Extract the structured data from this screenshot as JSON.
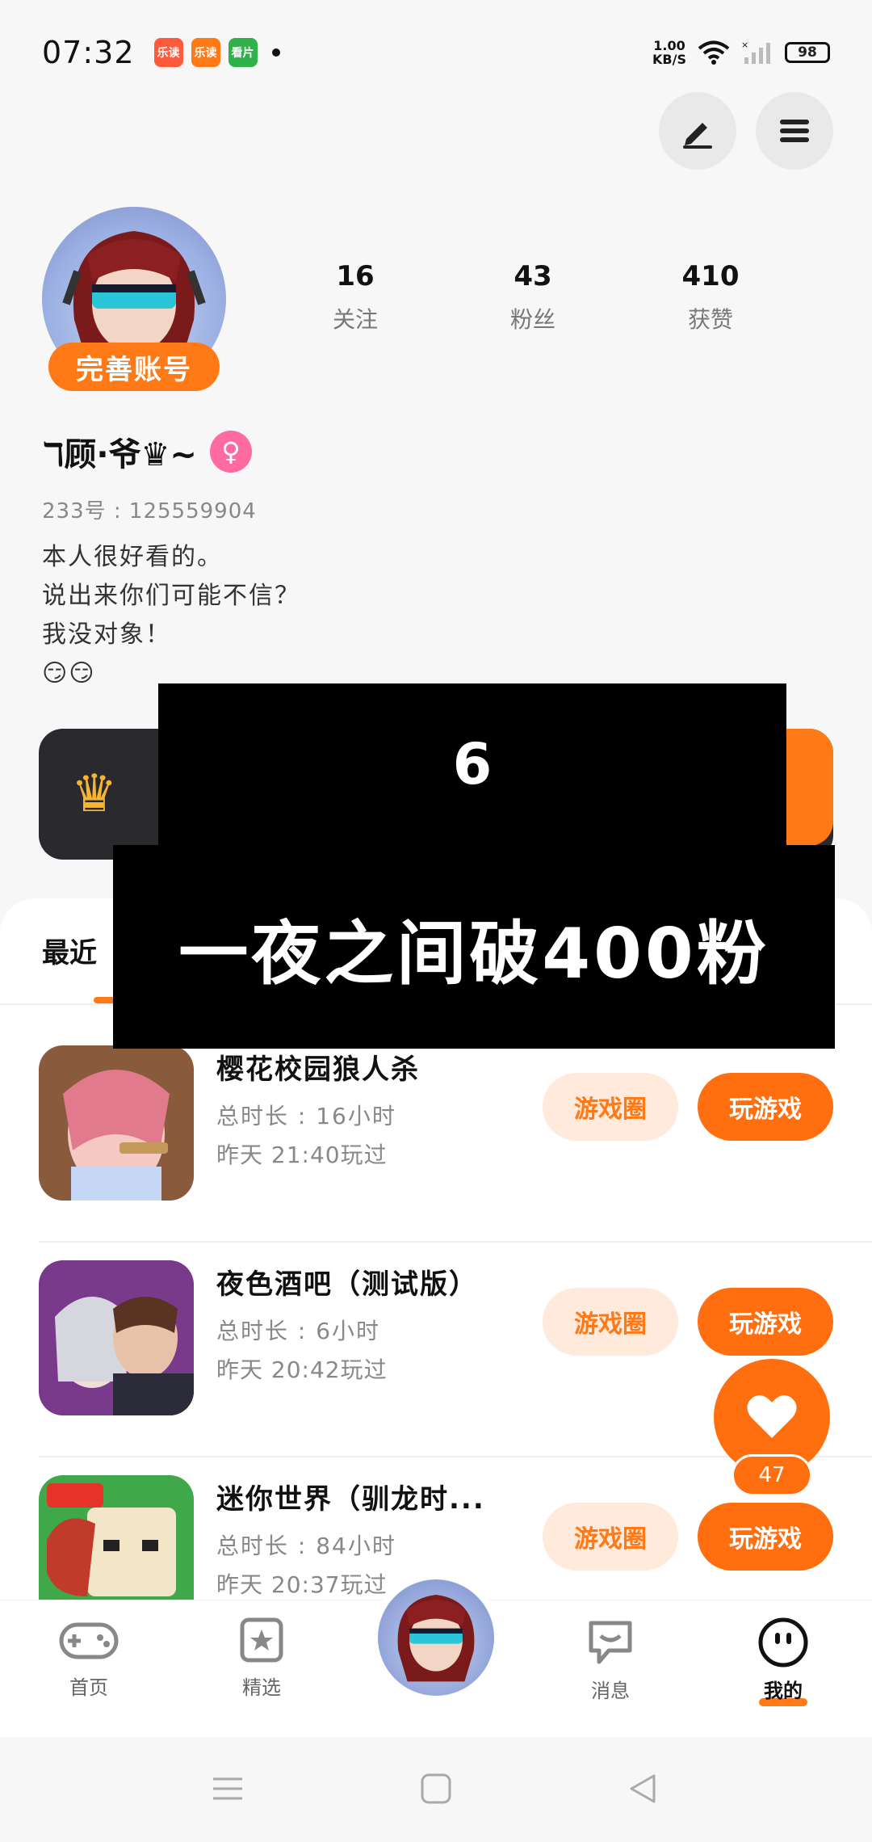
{
  "status_bar": {
    "time": "07:32",
    "net_speed_value": "1.00",
    "net_speed_unit": "KB/S",
    "battery": "98",
    "app_icons": [
      {
        "name": "app-icon-1",
        "color": "#ff5a3c",
        "label": "乐读"
      },
      {
        "name": "app-icon-2",
        "color": "#ff7a16",
        "label": "乐读"
      },
      {
        "name": "app-icon-3",
        "color": "#2fb14b",
        "label": "看片"
      }
    ]
  },
  "profile": {
    "complete_account_label": "完善账号",
    "nickname": "ℸ顾·爷♛~",
    "uid_label": "233号 : 125559904",
    "bio_lines": [
      "本人很好看的。",
      "说出来你们可能不信？",
      "我没对象！",
      "😏😏"
    ],
    "stats": [
      {
        "value": "16",
        "label": "关注"
      },
      {
        "value": "43",
        "label": "粉丝"
      },
      {
        "value": "410",
        "label": "获赞"
      }
    ]
  },
  "overlay": {
    "top_text": "6",
    "bottom_text": "一夜之间破400粉"
  },
  "tabs": {
    "recent": "最近"
  },
  "games": [
    {
      "title": "樱花校园狼人杀",
      "duration": "总时长 : 16小时",
      "last_played": "昨天 21:40玩过",
      "circle_btn": "游戏圈",
      "play_btn": "玩游戏"
    },
    {
      "title": "夜色酒吧（测试版）",
      "duration": "总时长 : 6小时",
      "last_played": "昨天 20:42玩过",
      "circle_btn": "游戏圈",
      "play_btn": "玩游戏"
    },
    {
      "title": "迷你世界（驯龙时...",
      "duration": "总时长 : 84小时",
      "last_played": "昨天 20:37玩过",
      "circle_btn": "游戏圈",
      "play_btn": "玩游戏"
    }
  ],
  "like": {
    "count": "47"
  },
  "bottom_nav": {
    "home": "首页",
    "featured": "精选",
    "messages": "消息",
    "mine": "我的"
  },
  "colors": {
    "accent": "#ff7a16",
    "accent_light": "#ffeadc",
    "vip_card": "#2a2a2e"
  }
}
